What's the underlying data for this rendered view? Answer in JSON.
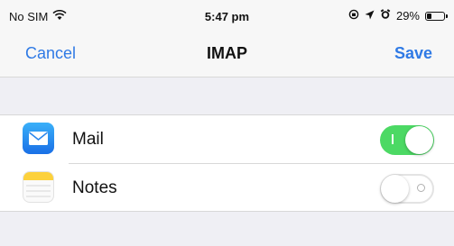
{
  "status_bar": {
    "carrier": "No SIM",
    "time": "5:47 pm",
    "battery_percent": "29%",
    "battery_level": 0.29,
    "icons": [
      "wifi-icon",
      "screen-rotation-lock-icon",
      "location-arrow-icon",
      "alarm-icon",
      "battery-icon"
    ]
  },
  "nav": {
    "cancel_label": "Cancel",
    "title": "IMAP",
    "save_label": "Save"
  },
  "settings": [
    {
      "label": "Mail",
      "icon": "mail-app-icon",
      "enabled": true
    },
    {
      "label": "Notes",
      "icon": "notes-app-icon",
      "enabled": false
    }
  ],
  "colors": {
    "accent": "#2f7ae5",
    "toggle_on": "#4cd964",
    "background": "#efeff4"
  }
}
